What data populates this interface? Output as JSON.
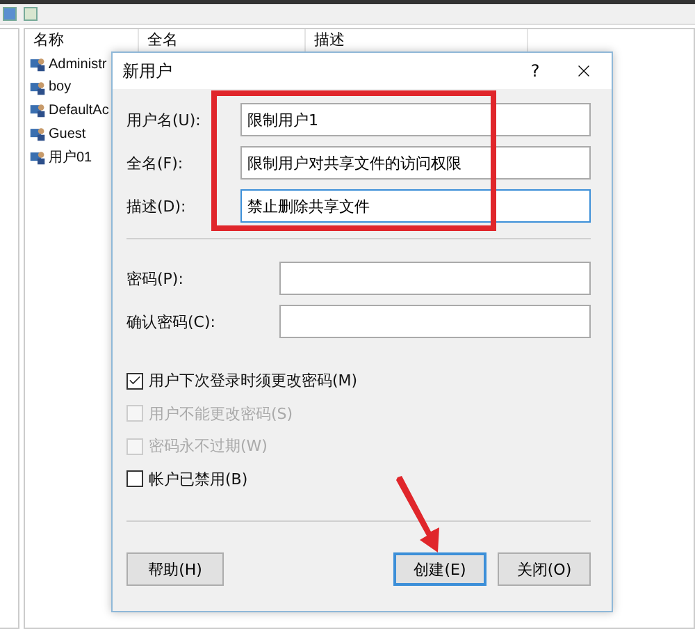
{
  "explorer": {
    "columns": [
      "名称",
      "全名",
      "描述"
    ],
    "users": [
      {
        "name": "Administr"
      },
      {
        "name": "boy"
      },
      {
        "name": "DefaultAc"
      },
      {
        "name": "Guest"
      },
      {
        "name": "用户01"
      }
    ]
  },
  "dialog": {
    "title": "新用户",
    "help_glyph": "?",
    "fields": [
      {
        "label": "用户名(U):",
        "value": "限制用户1",
        "focused": false
      },
      {
        "label": "全名(F):",
        "value": "限制用户对共享文件的访问权限",
        "focused": false
      },
      {
        "label": "描述(D):",
        "value": "禁止删除共享文件",
        "focused": true
      }
    ],
    "password_fields": [
      {
        "label": "密码(P):"
      },
      {
        "label": "确认密码(C):"
      }
    ],
    "options": [
      {
        "label": "用户下次登录时须更改密码(M)",
        "checked": true,
        "disabled": false
      },
      {
        "label": "用户不能更改密码(S)",
        "checked": false,
        "disabled": true
      },
      {
        "label": "密码永不过期(W)",
        "checked": false,
        "disabled": true
      },
      {
        "label": "帐户已禁用(B)",
        "checked": false,
        "disabled": false
      }
    ],
    "buttons": [
      {
        "label": "帮助(H)",
        "default": false
      },
      {
        "label": "创建(E)",
        "default": true
      },
      {
        "label": "关闭(O)",
        "default": false
      }
    ]
  }
}
